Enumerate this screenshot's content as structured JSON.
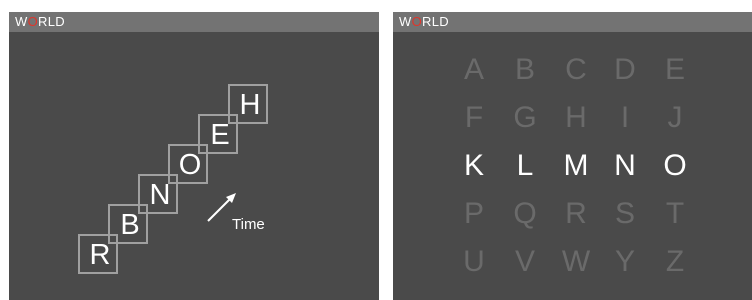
{
  "left_panel": {
    "title": {
      "before": "W",
      "highlight": "O",
      "after": "RLD"
    },
    "sequence": [
      "R",
      "B",
      "N",
      "O",
      "E",
      "H"
    ],
    "time_label": "Time"
  },
  "right_panel": {
    "title": {
      "before": "W",
      "highlight": "O",
      "after": "RLD"
    },
    "rows": [
      {
        "letters": [
          "A",
          "B",
          "C",
          "D",
          "E"
        ],
        "active": false
      },
      {
        "letters": [
          "F",
          "G",
          "H",
          "I",
          "J"
        ],
        "active": false
      },
      {
        "letters": [
          "K",
          "L",
          "M",
          "N",
          "O"
        ],
        "active": true
      },
      {
        "letters": [
          "P",
          "Q",
          "R",
          "S",
          "T"
        ],
        "active": false
      },
      {
        "letters": [
          "U",
          "V",
          "W",
          "Y",
          "Z"
        ],
        "active": false
      }
    ]
  },
  "colors": {
    "panel_bg": "#4a4a4a",
    "titlebar_bg": "#737373",
    "highlight_letter": "#e0352b",
    "active_letter": "#ffffff",
    "inactive_letter": "#6a6a6a",
    "box_border": "#a0a0a0"
  },
  "icons": {
    "time_arrow": "arrow-up-right-icon"
  }
}
